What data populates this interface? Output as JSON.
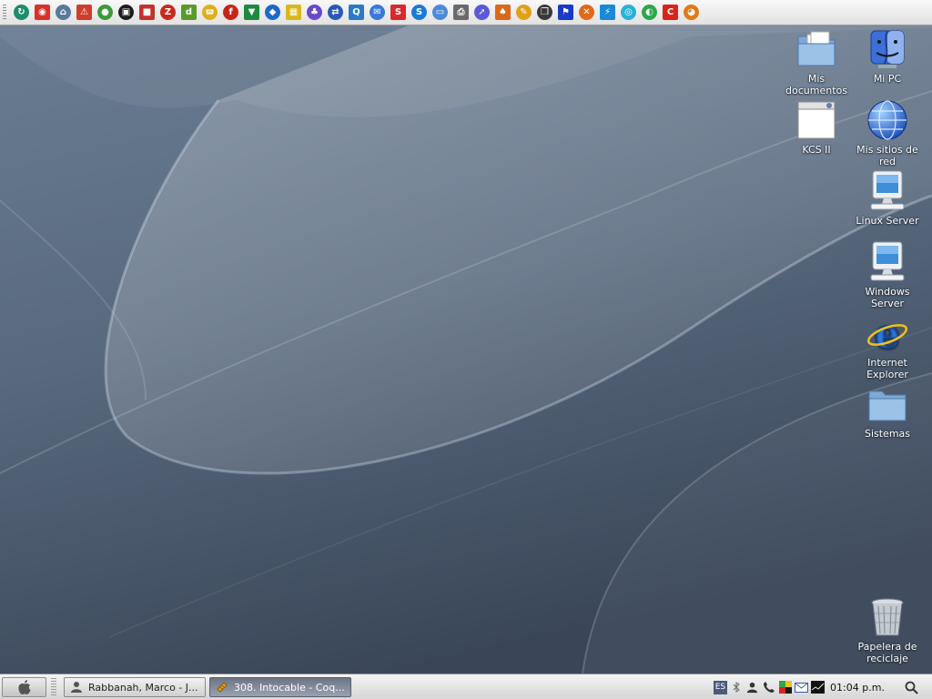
{
  "toolbar": {
    "launchers": [
      {
        "icon": "refresh-globe-icon",
        "color": "#1e8c6e",
        "glyph": "↻"
      },
      {
        "icon": "opera-lips-icon",
        "color": "#d8322a",
        "glyph": "◉"
      },
      {
        "icon": "house-network-icon",
        "color": "#5a7a9a",
        "glyph": "⌂"
      },
      {
        "icon": "warning-alert-icon",
        "color": "#d23c2a",
        "glyph": "⚠"
      },
      {
        "icon": "disc-burn-icon",
        "color": "#3d9a3a",
        "glyph": "●"
      },
      {
        "icon": "cpu-chip-icon",
        "color": "#1d1d1d",
        "glyph": "▣"
      },
      {
        "icon": "puzzle-blocks-icon",
        "color": "#c6312a",
        "glyph": "■"
      },
      {
        "icon": "filezilla-icon",
        "color": "#c92a1a",
        "glyph": "Z"
      },
      {
        "icon": "dreamweaver-icon",
        "color": "#5a9a2a",
        "glyph": "d"
      },
      {
        "icon": "winamp-icon",
        "color": "#e0b01a",
        "glyph": "ϖ"
      },
      {
        "icon": "flash-player-icon",
        "color": "#c8241a",
        "glyph": "f"
      },
      {
        "icon": "monitor-green-icon",
        "color": "#1d8a3d",
        "glyph": "▼"
      },
      {
        "icon": "cube-blue-icon",
        "color": "#1d6ac8",
        "glyph": "◆"
      },
      {
        "icon": "checkerboard-grid-icon",
        "color": "#d8b81a",
        "glyph": "▦"
      },
      {
        "icon": "network-people-icon",
        "color": "#6a4ac8",
        "glyph": "♣"
      },
      {
        "icon": "computer-transfer-icon",
        "color": "#2a5ab8",
        "glyph": "⇄"
      },
      {
        "icon": "magnify-search-icon",
        "color": "#2a7ac8",
        "glyph": "Q"
      },
      {
        "icon": "chat-bubble-icon",
        "color": "#3a7ad8",
        "glyph": "✉"
      },
      {
        "icon": "skype-icon",
        "color": "#d82a2a",
        "glyph": "S"
      },
      {
        "icon": "skype-blue-icon",
        "color": "#1a7ad8",
        "glyph": "S"
      },
      {
        "icon": "screen-window-icon",
        "color": "#4a8ad8",
        "glyph": "▭"
      },
      {
        "icon": "printer-users-icon",
        "color": "#6a6a6a",
        "glyph": "⎙"
      },
      {
        "icon": "arrow-curve-icon",
        "color": "#5a5ad8",
        "glyph": "➚"
      },
      {
        "icon": "key-tool-icon",
        "color": "#d86a1a",
        "glyph": "♠"
      },
      {
        "icon": "ticket-orange-icon",
        "color": "#e0a01a",
        "glyph": "✎"
      },
      {
        "icon": "stacked-windows-icon",
        "color": "#3a3a3a",
        "glyph": "❐"
      },
      {
        "icon": "flag-blue-icon",
        "color": "#1a3ac8",
        "glyph": "⚑"
      },
      {
        "icon": "scissors-x-icon",
        "color": "#e06a1a",
        "glyph": "✕"
      },
      {
        "icon": "lightning-bolt-icon",
        "color": "#1a8ad8",
        "glyph": "⚡"
      },
      {
        "icon": "disc-blue-icon",
        "color": "#2ab0d8",
        "glyph": "◎"
      },
      {
        "icon": "globe-green-icon",
        "color": "#2aa84a",
        "glyph": "◐"
      },
      {
        "icon": "opera-red-icon",
        "color": "#d8241a",
        "glyph": "C"
      },
      {
        "icon": "firefox-icon",
        "color": "#e07a1a",
        "glyph": "◕"
      }
    ]
  },
  "desktop": {
    "icons": [
      {
        "name": "mis-documentos",
        "label": "Mis documentos"
      },
      {
        "name": "mi-pc",
        "label": "Mi PC"
      },
      {
        "name": "kcs-ii",
        "label": "KCS II"
      },
      {
        "name": "mis-sitios-de-red",
        "label": "Mis sitios de red"
      },
      {
        "name": "linux-server",
        "label": "Linux Server"
      },
      {
        "name": "windows-server",
        "label": "Windows Server"
      },
      {
        "name": "internet-explorer",
        "label": "Internet Explorer"
      },
      {
        "name": "sistemas",
        "label": "Sistemas"
      },
      {
        "name": "papelera-de-reciclaje",
        "label": "Papelera de reciclaje"
      }
    ]
  },
  "taskbar": {
    "start_icon": "apple-icon",
    "tasks": [
      {
        "label": "Rabbanah, Marco - J...",
        "icon": "user-icon",
        "state": "inactive"
      },
      {
        "label": "308. Intocable - Coq...",
        "icon": "ticket-orange-icon",
        "state": "active"
      }
    ],
    "tray": {
      "language": "ES",
      "icons": [
        "bluetooth-icon",
        "user-status-icon",
        "phone-icon",
        "color-squares-icon",
        "mail-icon",
        "monitor-graph-icon"
      ]
    },
    "clock": "01:04 p.m.",
    "search_icon": "search-icon"
  },
  "colors": {
    "wallpaper": "#5b6b80",
    "taskbar_active": "#7a8292",
    "folder_blue": "#8ab6e0"
  }
}
